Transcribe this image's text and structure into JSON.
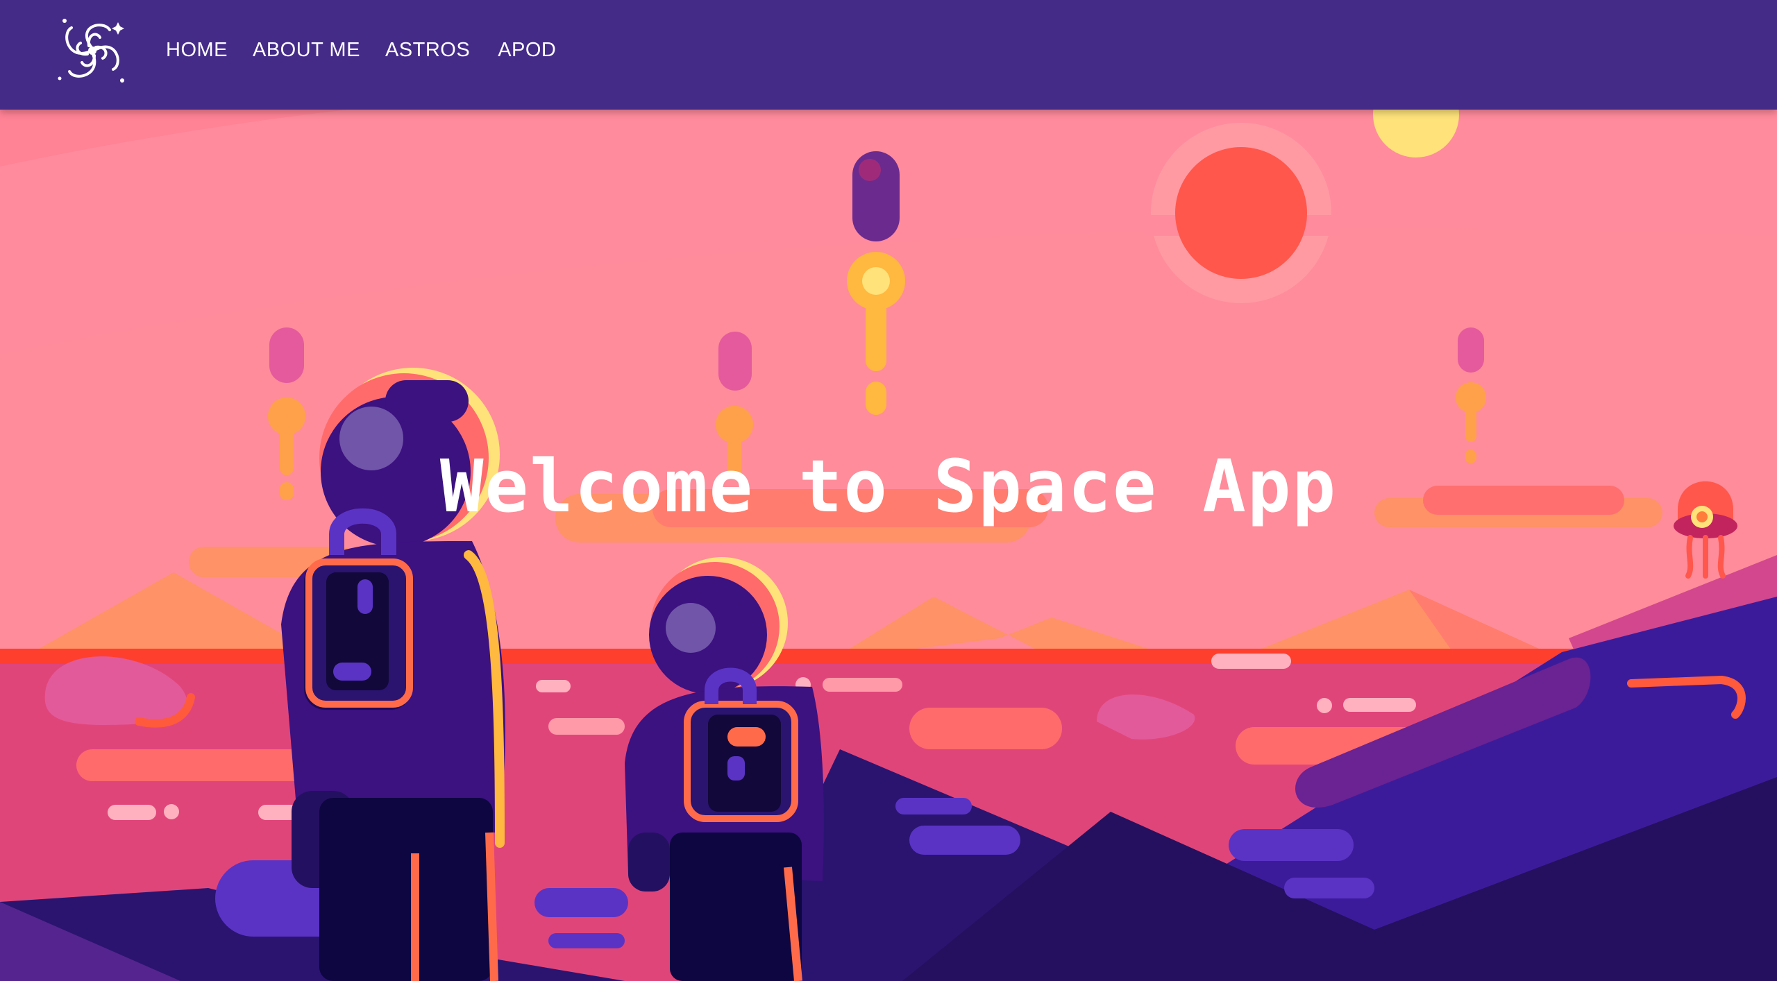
{
  "nav": {
    "logo_icon": "galaxy-swirl-icon",
    "links": [
      {
        "label": "HOME"
      },
      {
        "label": "ABOUT ME"
      },
      {
        "label": "ASTROS"
      },
      {
        "label": "APOD"
      }
    ]
  },
  "hero": {
    "title": "Welcome to Space App"
  },
  "colors": {
    "navbar": "#452b88",
    "sky": "#ff8a9a",
    "sun": "#ff5a4c",
    "ground": "#e0457a",
    "mountains": "#2a1470"
  }
}
